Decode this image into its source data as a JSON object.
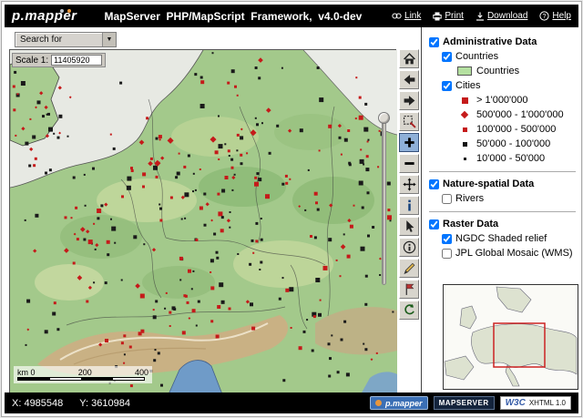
{
  "header": {
    "logo": "p.mapper",
    "title": "MapServer  PHP/MapScript  Framework,  v4.0-dev",
    "links": [
      {
        "label": "Link",
        "icon": "link-icon"
      },
      {
        "label": "Print",
        "icon": "print-icon"
      },
      {
        "label": "Download",
        "icon": "download-icon"
      },
      {
        "label": "Help",
        "icon": "help-icon"
      }
    ]
  },
  "map": {
    "search_label": "Search for",
    "scale_label": "Scale 1:",
    "scale_value": "11405920",
    "scalebar": {
      "unit_label": "km 0",
      "tick1": "200",
      "tick2": "400"
    }
  },
  "toolbar": {
    "buttons": [
      {
        "name": "home",
        "icon": "home-icon"
      },
      {
        "name": "back",
        "icon": "arrow-left-icon"
      },
      {
        "name": "forward",
        "icon": "arrow-right-icon"
      },
      {
        "name": "zoom-selected",
        "icon": "zoom-selected-icon"
      },
      {
        "name": "zoom-in",
        "icon": "plus-icon",
        "active": true
      },
      {
        "name": "zoom-out",
        "icon": "minus-icon"
      },
      {
        "name": "pan",
        "icon": "pan-arrows-icon"
      },
      {
        "name": "identify",
        "icon": "identify-i-icon"
      },
      {
        "name": "select",
        "icon": "cursor-icon"
      },
      {
        "name": "tooltip",
        "icon": "info-circle-icon"
      },
      {
        "name": "measure",
        "icon": "pencil-icon"
      },
      {
        "name": "add-point",
        "icon": "flag-icon"
      },
      {
        "name": "refresh",
        "icon": "refresh-icon"
      }
    ]
  },
  "legend": {
    "groups": [
      {
        "label": "Administrative Data",
        "checked": true,
        "layers": [
          {
            "label": "Countries",
            "checked": true,
            "classes": [
              {
                "label": "Countries",
                "symbol": "green-fill-swatch"
              }
            ]
          },
          {
            "label": "Cities",
            "checked": true,
            "classes": [
              {
                "label": "> 1'000'000",
                "symbol": "red-square-large"
              },
              {
                "label": "500'000 - 1'000'000",
                "symbol": "red-diamond"
              },
              {
                "label": "100'000 - 500'000",
                "symbol": "red-square-small"
              },
              {
                "label": "50'000 - 100'000",
                "symbol": "black-square"
              },
              {
                "label": "10'000 - 50'000",
                "symbol": "black-dot"
              }
            ]
          }
        ]
      },
      {
        "label": "Nature-spatial Data",
        "checked": true,
        "layers": [
          {
            "label": "Rivers",
            "checked": false,
            "classes": []
          }
        ]
      },
      {
        "label": "Raster Data",
        "checked": true,
        "layers": [
          {
            "label": "NGDC Shaded relief",
            "checked": true,
            "classes": []
          },
          {
            "label": "JPL Global Mosaic (WMS)",
            "checked": false,
            "classes": []
          }
        ]
      }
    ]
  },
  "statusbar": {
    "x_text": "X: 4985548",
    "y_text": "Y: 3610984",
    "badges": {
      "pmapper": "p.mapper",
      "mapserver": "MAPSERVER",
      "w3c_left": "W3C",
      "w3c_right": "XHTML 1.0"
    }
  },
  "colors": {
    "city_red": "#c51a1a",
    "city_black": "#1a1a1a",
    "land_green": "#a3c98b",
    "legend_green": "#b4e0a0",
    "active_tool_blue": "#8fb0d8"
  }
}
